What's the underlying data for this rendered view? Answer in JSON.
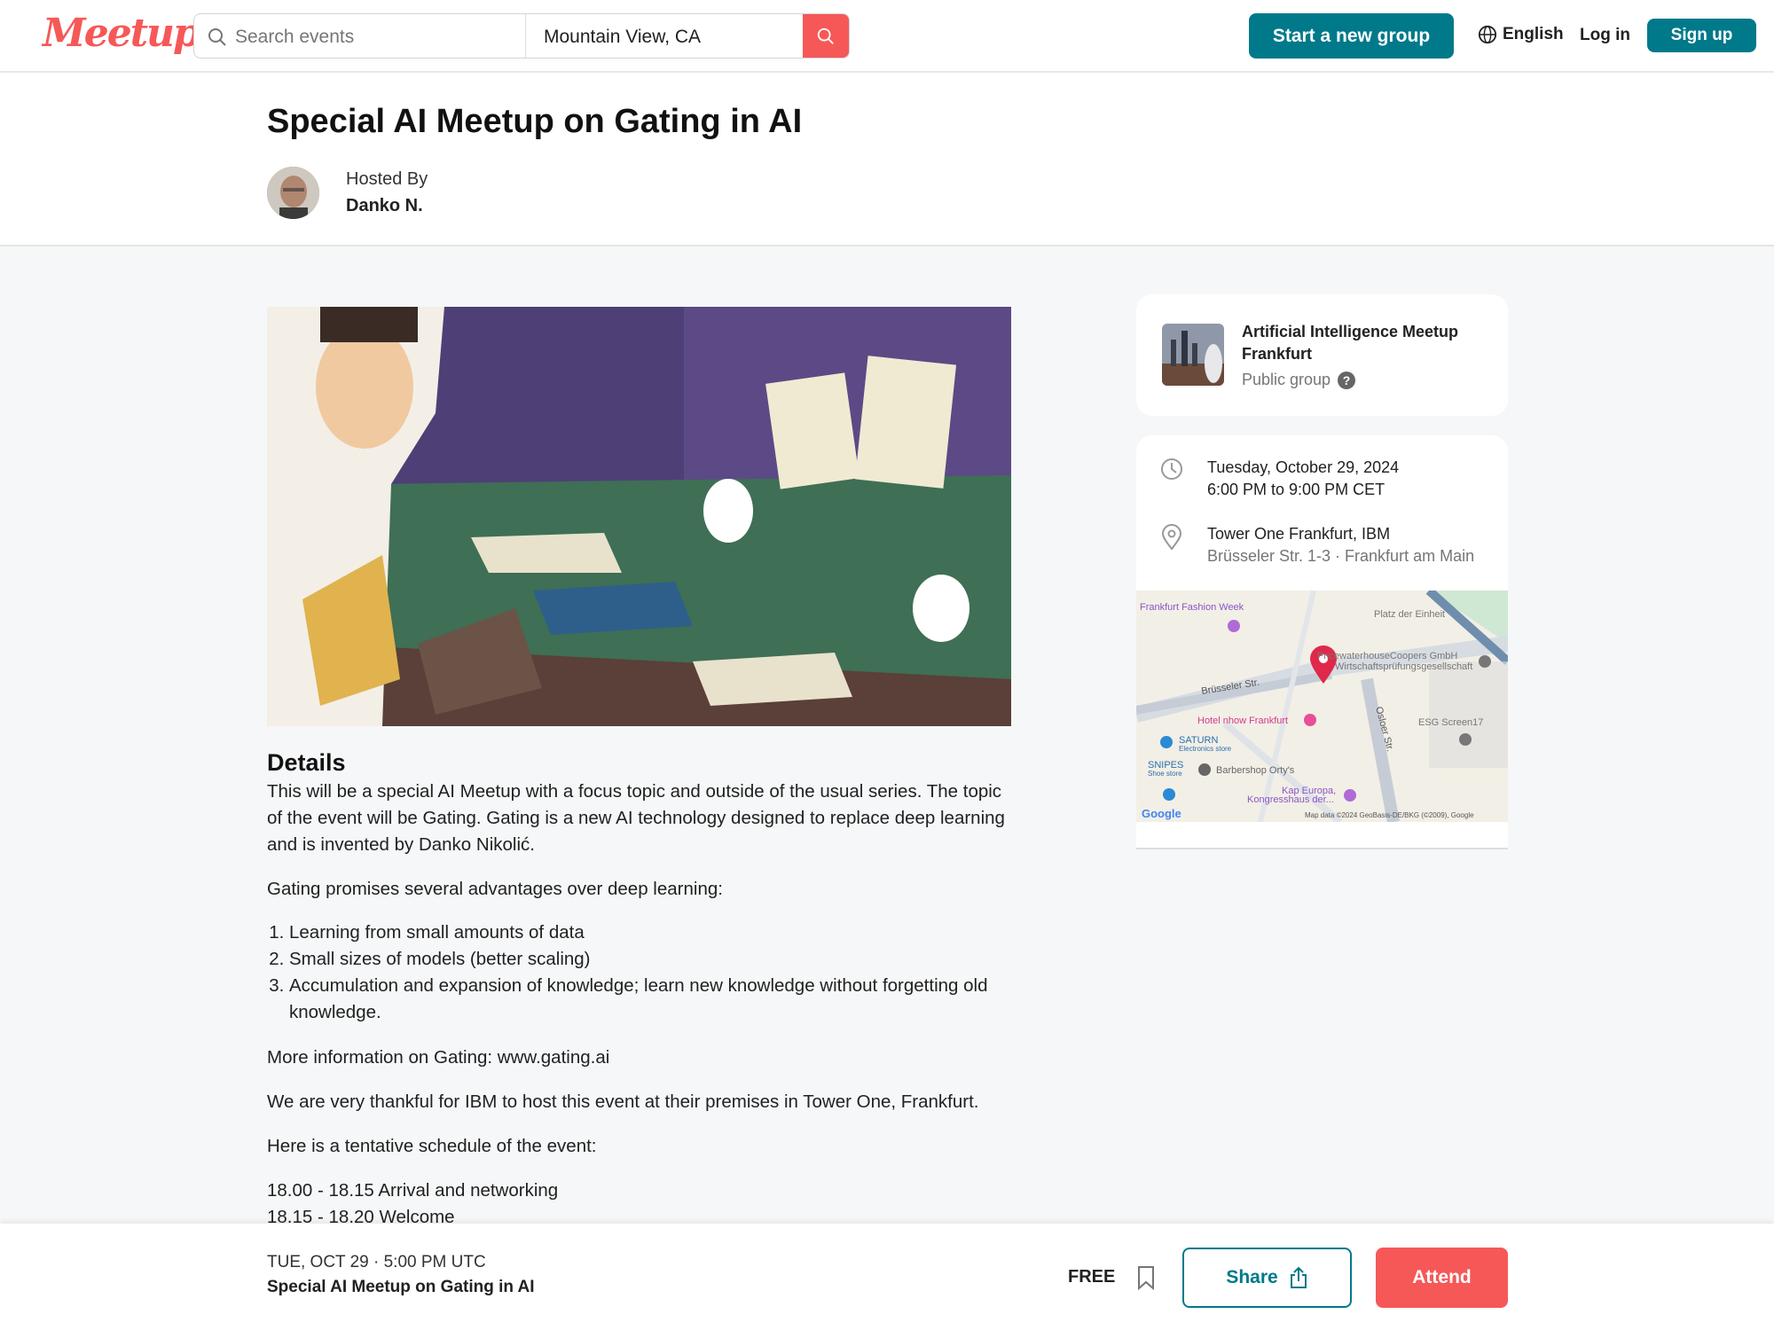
{
  "header": {
    "logo": "Meetup",
    "search_placeholder": "Search events",
    "location": "Mountain View, CA",
    "start_group": "Start a new group",
    "language": "English",
    "login": "Log in",
    "signup": "Sign up"
  },
  "event": {
    "title": "Special AI Meetup on Gating in AI",
    "hosted_by_label": "Hosted By",
    "host": "Danko N."
  },
  "details": {
    "heading": "Details",
    "intro": "This will be a special AI Meetup with a focus topic and outside of the usual series. The topic of the event will be Gating. Gating is a new AI technology designed to replace deep learning and is invented by Danko Nikolić.",
    "advantages_intro": "Gating promises several advantages over deep learning:",
    "advantages": [
      "Learning from small amounts of data",
      "Small sizes of models (better scaling)",
      "Accumulation and expansion of knowledge; learn new knowledge without forgetting old knowledge."
    ],
    "more_info": "More information on Gating: www.gating.ai",
    "thanks": "We are very thankful for IBM to host this event at their premises in Tower One, Frankfurt.",
    "schedule_intro": "Here is a tentative schedule of the event:",
    "schedule": [
      "18.00 - 18.15 Arrival and networking",
      "18.15 - 18.20 Welcome"
    ]
  },
  "group": {
    "name": "Artificial Intelligence Meetup Frankfurt",
    "type": "Public group"
  },
  "when": {
    "date": "Tuesday, October 29, 2024",
    "time": "6:00 PM to 9:00 PM CET"
  },
  "where": {
    "venue": "Tower One Frankfurt, IBM",
    "address": "Brüsseler Str. 1-3 · Frankfurt am Main"
  },
  "map": {
    "labels": [
      "Frankfurt Fashion Week",
      "Platz der Einheit",
      "PricewaterhouseCoopers GmbH",
      "Wirtschaftsprüfungsgesellschaft",
      "Brüsseler Str.",
      "Hotel nhow Frankfurt",
      "Osloer Str.",
      "ESG Screen17",
      "SATURN",
      "Electronics store",
      "SNIPES",
      "Shoe store",
      "Barbershop Orty's",
      "Kap Europa,",
      "Kongresshaus der...",
      "Google",
      "Map data ©2024 GeoBasis-DE/BKG (©2009), Google"
    ]
  },
  "bottom_bar": {
    "datetime": "TUE, OCT 29 · 5:00 PM UTC",
    "title": "Special AI Meetup on Gating in AI",
    "price": "FREE",
    "share": "Share",
    "attend": "Attend"
  },
  "colors": {
    "brand": "#f65858",
    "teal": "#00798a"
  }
}
